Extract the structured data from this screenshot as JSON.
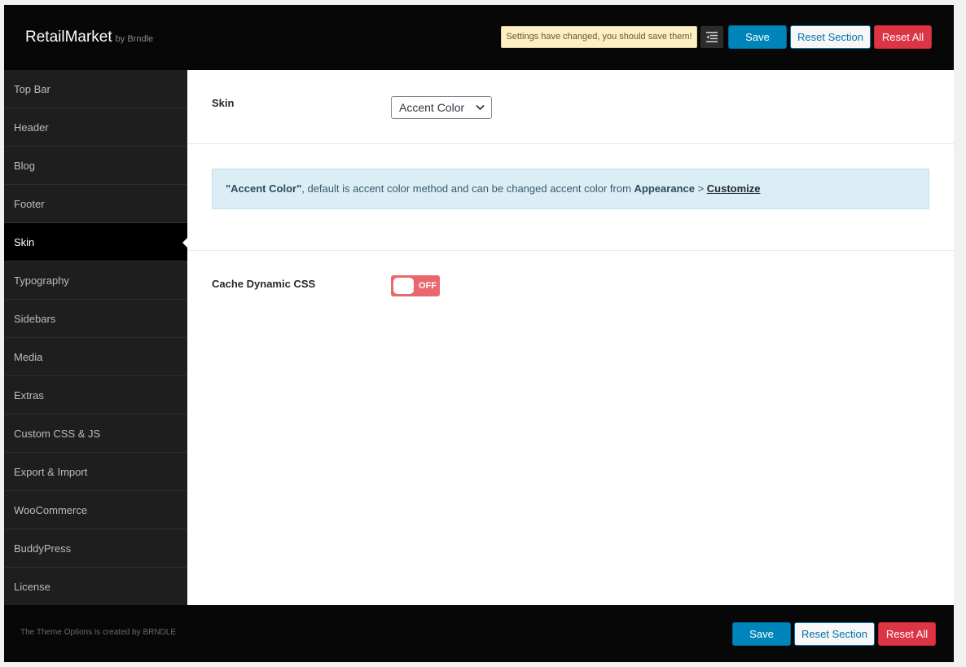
{
  "header": {
    "brand": "RetailMarket",
    "brand_by": "by Brndle",
    "notice": "Settings have changed, you should save them!",
    "expand_icon": "expand-menu-icon",
    "save_label": "Save",
    "reset_section_label": "Reset Section",
    "reset_all_label": "Reset All"
  },
  "sidebar": {
    "items": [
      {
        "label": "Top Bar"
      },
      {
        "label": "Header"
      },
      {
        "label": "Blog"
      },
      {
        "label": "Footer"
      },
      {
        "label": "Skin"
      },
      {
        "label": "Typography"
      },
      {
        "label": "Sidebars"
      },
      {
        "label": "Media"
      },
      {
        "label": "Extras"
      },
      {
        "label": "Custom CSS & JS"
      },
      {
        "label": "Export & Import"
      },
      {
        "label": "WooCommerce"
      },
      {
        "label": "BuddyPress"
      },
      {
        "label": "License"
      }
    ],
    "active": "Skin"
  },
  "main": {
    "skin_label": "Skin",
    "skin_value": "Accent Color",
    "info": {
      "term": "\"Accent Color\"",
      "text": ", default is accent color method and can be changed accent color from ",
      "appearance": "Appearance",
      "sep": " > ",
      "customize": "Customize"
    },
    "cache_label": "Cache Dynamic CSS",
    "cache_state": "OFF"
  },
  "footer": {
    "credit": "The Theme Options is created by BRNDLE",
    "save_label": "Save",
    "reset_section_label": "Reset Section",
    "reset_all_label": "Reset All"
  },
  "colors": {
    "accent_blue": "#0085ba",
    "danger_red": "#dc3545",
    "toggle_off": "#e9686d",
    "info_bg": "#dbeef6"
  }
}
